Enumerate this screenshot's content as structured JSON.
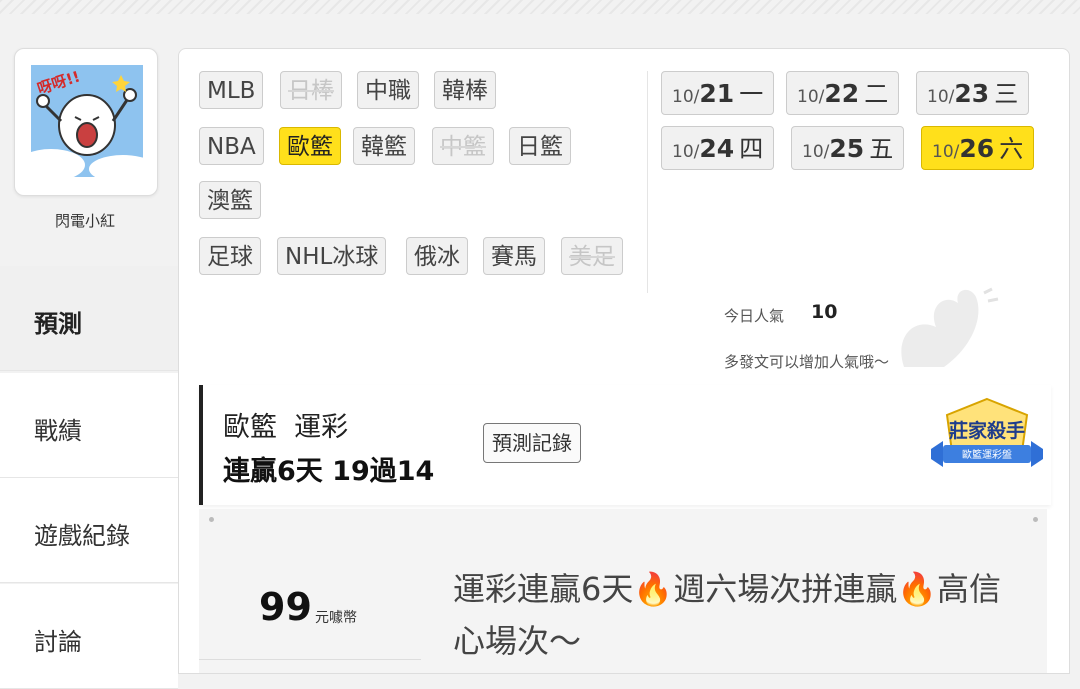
{
  "user": {
    "name": "閃電小紅",
    "avatar_caption": "呀呀!!"
  },
  "menu": [
    {
      "label": "預測",
      "active": true
    },
    {
      "label": "戰績",
      "active": false
    },
    {
      "label": "遊戲紀錄",
      "active": false
    },
    {
      "label": "討論",
      "active": false
    }
  ],
  "sports": [
    [
      {
        "label": "MLB",
        "state": "normal"
      },
      {
        "label": "日棒",
        "state": "disabled"
      },
      {
        "label": "中職",
        "state": "normal"
      },
      {
        "label": "韓棒",
        "state": "normal"
      }
    ],
    [
      {
        "label": "NBA",
        "state": "normal"
      },
      {
        "label": "歐籃",
        "state": "selected"
      },
      {
        "label": "韓籃",
        "state": "normal"
      },
      {
        "label": "中籃",
        "state": "disabled"
      },
      {
        "label": "日籃",
        "state": "normal"
      }
    ],
    [
      {
        "label": "澳籃",
        "state": "normal"
      }
    ],
    [
      {
        "label": "足球",
        "state": "normal"
      },
      {
        "label": "NHL冰球",
        "state": "normal"
      },
      {
        "label": "俄冰",
        "state": "normal"
      },
      {
        "label": "賽馬",
        "state": "normal"
      },
      {
        "label": "美足",
        "state": "disabled"
      }
    ]
  ],
  "dates": [
    {
      "month": "10/",
      "day": "21",
      "weekday": "一",
      "selected": false
    },
    {
      "month": "10/",
      "day": "22",
      "weekday": "二",
      "selected": false
    },
    {
      "month": "10/",
      "day": "23",
      "weekday": "三",
      "selected": false
    },
    {
      "month": "10/",
      "day": "24",
      "weekday": "四",
      "selected": false
    },
    {
      "month": "10/",
      "day": "25",
      "weekday": "五",
      "selected": false
    },
    {
      "month": "10/",
      "day": "26",
      "weekday": "六",
      "selected": true
    }
  ],
  "popularity": {
    "label": "今日人氣",
    "value": "10",
    "hint": "多發文可以增加人氣哦～"
  },
  "record": {
    "category": "歐籃  運彩",
    "streak": "連贏6天 19過14",
    "button": "預測記錄",
    "badge_title": "莊家殺手",
    "badge_sub": "歐籃運彩盤"
  },
  "post": {
    "price": "99",
    "price_unit": "元噱幣",
    "title": "運彩連贏6天🔥週六場次拼連贏🔥高信心場次～"
  },
  "colors": {
    "selected": "#ffe01b",
    "accent_dark": "#222222"
  }
}
